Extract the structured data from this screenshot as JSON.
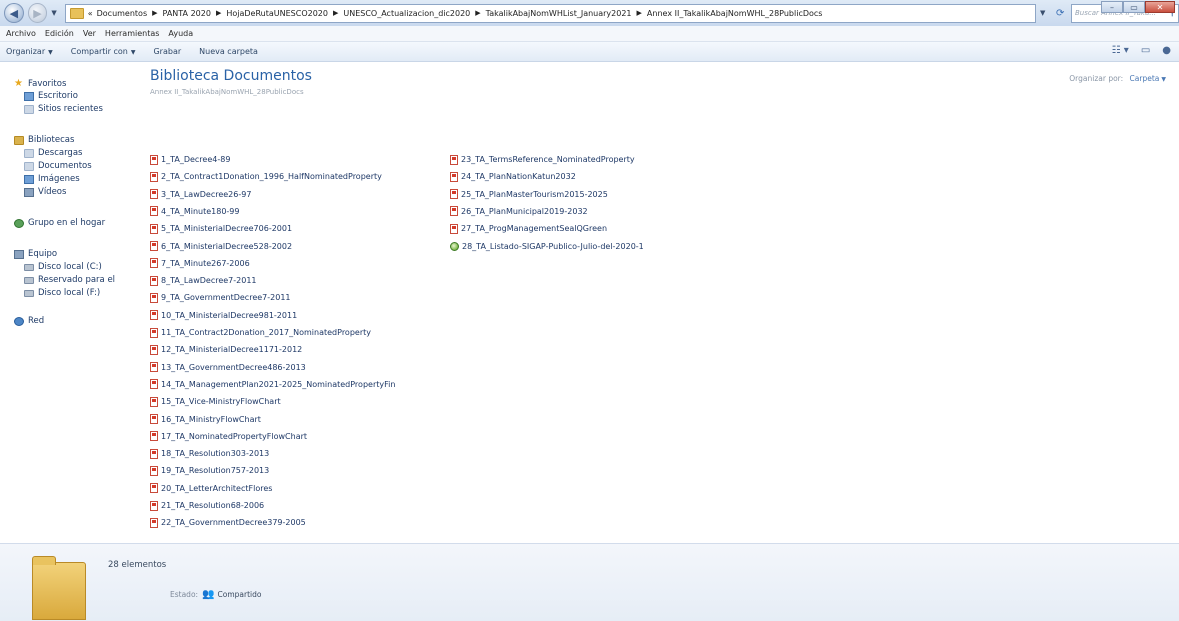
{
  "address_bar": {
    "lead": "«",
    "crumbs": [
      "Documentos",
      "PANTA 2020",
      "HojaDeRutaUNESCO2020",
      "UNESCO_Actualizacion_dic2020",
      "TakalikAbajNomWHList_January2021",
      "Annex II_TakalikAbajNomWHL_28PublicDocs"
    ],
    "search_placeholder": "Buscar Annex II_Taka..."
  },
  "menu": [
    "Archivo",
    "Edición",
    "Ver",
    "Herramientas",
    "Ayuda"
  ],
  "toolbar": {
    "organize": "Organizar",
    "share": "Compartir con",
    "burn": "Grabar",
    "new_folder": "Nueva carpeta"
  },
  "nav": {
    "favorites": "Favoritos",
    "desktop": "Escritorio",
    "recent": "Sitios recientes",
    "libraries": "Bibliotecas",
    "downloads": "Descargas",
    "documents": "Documentos",
    "images": "Imágenes",
    "videos": "Vídeos",
    "homegroup": "Grupo en el hogar",
    "computer": "Equipo",
    "disk_c": "Disco local (C:)",
    "reserved": "Reservado para el",
    "disk_f": "Disco local (F:)",
    "network": "Red"
  },
  "content": {
    "title": "Biblioteca Documentos",
    "subtitle": "Annex II_TakalikAbajNomWHL_28PublicDocs",
    "arrange_label": "Organizar por:",
    "arrange_value": "Carpeta"
  },
  "files_col1": [
    "1_TA_Decree4-89",
    "2_TA_Contract1Donation_1996_HalfNominatedProperty",
    "3_TA_LawDecree26-97",
    "4_TA_Minute180-99",
    "5_TA_MinisterialDecree706-2001",
    "6_TA_MinisterialDecree528-2002",
    "7_TA_Minute267-2006",
    "8_TA_LawDecree7-2011",
    "9_TA_GovernmentDecree7-2011",
    "10_TA_MinisterialDecree981-2011",
    "11_TA_Contract2Donation_2017_NominatedProperty",
    "12_TA_MinisterialDecree1171-2012",
    "13_TA_GovernmentDecree486-2013",
    "14_TA_ManagementPlan2021-2025_NominatedPropertyFin",
    "15_TA_Vice-MinistryFlowChart",
    "16_TA_MinistryFlowChart",
    "17_TA_NominatedPropertyFlowChart",
    "18_TA_Resolution303-2013",
    "19_TA_Resolution757-2013",
    "20_TA_LetterArchitectFlores",
    "21_TA_Resolution68-2006",
    "22_TA_GovernmentDecree379-2005"
  ],
  "files_col2": [
    "23_TA_TermsReference_NominatedProperty",
    "24_TA_PlanNationKatun2032",
    "25_TA_PlanMasterTourism2015-2025",
    "26_TA_PlanMunicipal2019-2032",
    "27_TA_ProgManagementSealQGreen",
    "28_TA_Listado-SIGAP-Publico-Julio-del-2020-1"
  ],
  "details": {
    "count": "28 elementos",
    "state_label": "Estado:",
    "state_value": "Compartido"
  }
}
